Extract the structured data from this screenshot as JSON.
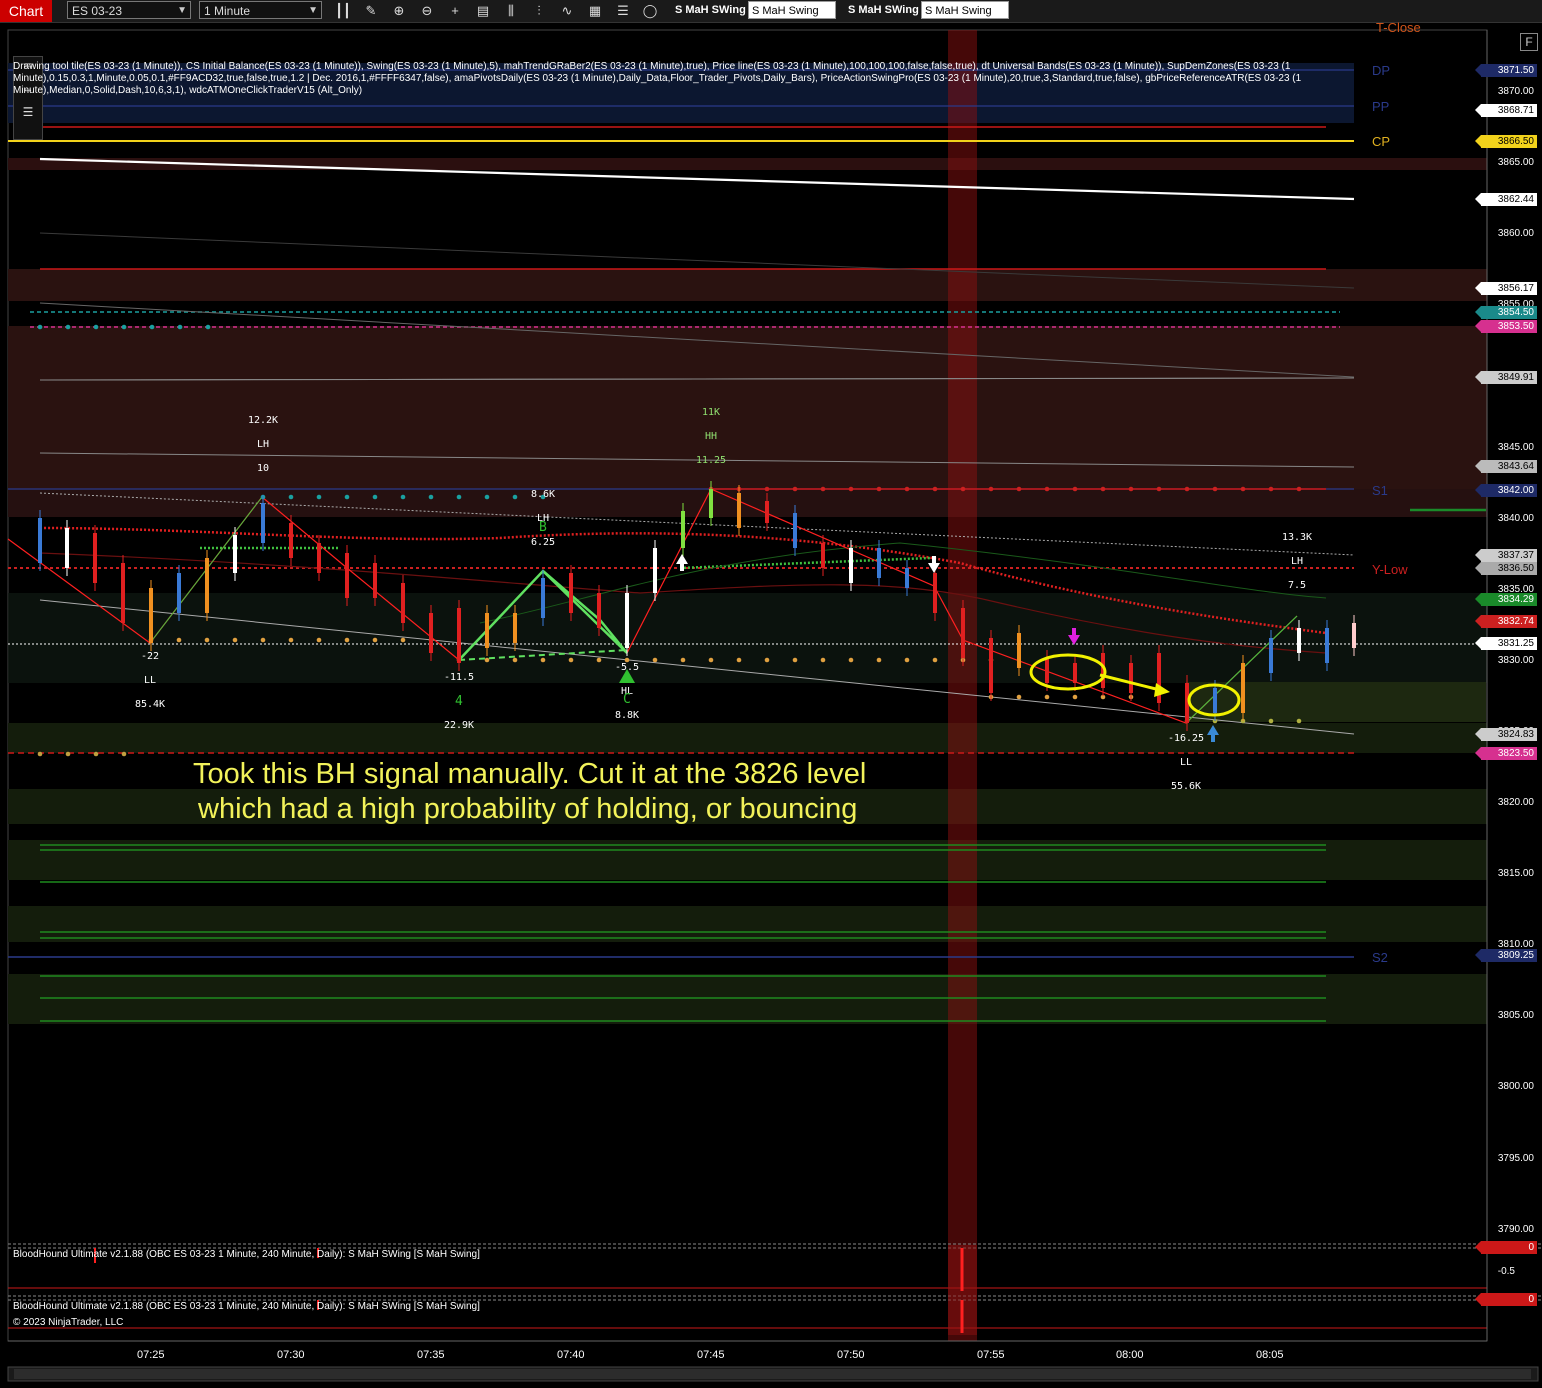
{
  "toolbar": {
    "tab_label": "Chart",
    "instrument": "ES 03-23",
    "interval": "1 Minute",
    "buttons": [
      {
        "label": "S MaH SWing",
        "style": "dark"
      },
      {
        "label": "S MaH Swing",
        "style": "light"
      },
      {
        "label": "S MaH SWing",
        "style": "dark"
      },
      {
        "label": "S MaH Swing",
        "style": "light"
      }
    ]
  },
  "indicator_text": "Drawing tool tile(ES 03-23 (1 Minute)), CS Initial Balance(ES 03-23 (1 Minute)), Swing(ES 03-23 (1 Minute),5), mahTrendGRaBer2(ES 03-23 (1 Minute),true), Price line(ES 03-23 (1 Minute),100,100,100,false,false,true), dt Universal Bands(ES 03-23 (1 Minute)), SupDemZones(ES 03-23 (1 Minute),0.15,0.3,1,Minute,0.05,0.1,#FF9ACD32,true,false,true,1.2 | Dec. 2016,1,#FFFF6347,false), amaPivotsDaily(ES 03-23 (1 Minute),Daily_Data,Floor_Trader_Pivots,Daily_Bars), PriceActionSwingPro(ES 03-23 (1 Minute),20,true,3,Standard,true,false), gbPriceReferenceATR(ES 03-23 (1 Minute),Median,0,Solid,Dash,10,6,3,1), wdcATMOneClickTraderV15 (Alt_Only)",
  "f_button": "F",
  "y_axis_ticks": [
    "3870.00",
    "3865.00",
    "3860.00",
    "3855.00",
    "3850.00",
    "3845.00",
    "3840.00",
    "3835.00",
    "3830.00",
    "3825.00",
    "3820.00",
    "3815.00",
    "3810.00",
    "3805.00",
    "3800.00",
    "3795.00",
    "3790.00"
  ],
  "price_tags": [
    {
      "value": "3871.50",
      "bg": "#1e2a66",
      "fg": "#ffffff"
    },
    {
      "value": "3868.71",
      "bg": "#ffffff",
      "fg": "#000000"
    },
    {
      "value": "3866.50",
      "bg": "#f2d21b",
      "fg": "#000000"
    },
    {
      "value": "3862.44",
      "bg": "#ffffff",
      "fg": "#000000"
    },
    {
      "value": "3856.17",
      "bg": "#ffffff",
      "fg": "#000000"
    },
    {
      "value": "3854.50",
      "bg": "#1a8a8a",
      "fg": "#ffffff"
    },
    {
      "value": "3853.50",
      "bg": "#d6308f",
      "fg": "#ffffff"
    },
    {
      "value": "3849.91",
      "bg": "#cccccc",
      "fg": "#000000"
    },
    {
      "value": "3843.64",
      "bg": "#bbbbbb",
      "fg": "#000000"
    },
    {
      "value": "3842.00",
      "bg": "#1e2a66",
      "fg": "#ffffff"
    },
    {
      "value": "3837.37",
      "bg": "#cccccc",
      "fg": "#000000"
    },
    {
      "value": "3836.50",
      "bg": "#aaaaaa",
      "fg": "#000000"
    },
    {
      "value": "3834.29",
      "bg": "#1a8a2a",
      "fg": "#ffffff"
    },
    {
      "value": "3832.74",
      "bg": "#cc2020",
      "fg": "#ffffff"
    },
    {
      "value": "3831.25",
      "bg": "#ffffff",
      "fg": "#000000"
    },
    {
      "value": "3824.83",
      "bg": "#cccccc",
      "fg": "#000000"
    },
    {
      "value": "3823.50",
      "bg": "#d6308f",
      "fg": "#ffffff"
    },
    {
      "value": "3809.25",
      "bg": "#1e2a66",
      "fg": "#ffffff"
    }
  ],
  "pivot_labels": [
    {
      "text": "T-Close",
      "color": "#d0541a"
    },
    {
      "text": "DP",
      "color": "#2a3a8a"
    },
    {
      "text": "PP",
      "color": "#2a3a8a"
    },
    {
      "text": "CP",
      "color": "#e0b020"
    },
    {
      "text": "S1",
      "color": "#2a3a8a"
    },
    {
      "text": "Y-Low",
      "color": "#cc2020"
    },
    {
      "text": "S2",
      "color": "#2a3a8a"
    }
  ],
  "swing_annotations": [
    {
      "lines": [
        "12.2K",
        "LH",
        "10"
      ],
      "color": "#ffffff"
    },
    {
      "lines": [
        "-22",
        "LL",
        "85.4K"
      ],
      "color": "#ffffff"
    },
    {
      "lines": [
        "-11.5",
        "",
        "22.9K"
      ],
      "color": "#ffffff"
    },
    {
      "lines": [
        "8.6K",
        "LH",
        "6.25"
      ],
      "color": "#ffffff"
    },
    {
      "lines": [
        "11K",
        "HH",
        "11.25"
      ],
      "color": "#90e070"
    },
    {
      "lines": [
        "-5.5",
        "HL",
        "8.8K"
      ],
      "color": "#ffffff"
    },
    {
      "lines": [
        "13.3K",
        "LH",
        "7.5"
      ],
      "color": "#ffffff"
    },
    {
      "lines": [
        "-16.25",
        "LL",
        "55.6K"
      ],
      "color": "#ffffff"
    }
  ],
  "pattern_letters": [
    "4",
    "B",
    "C"
  ],
  "comment": [
    "Took this BH signal manually. Cut it at the 3826 level",
    "which had a high probability of holding, or bouncing"
  ],
  "sub_panels": [
    {
      "title": "BloodHound Ultimate v2.1.88 (OBC ES 03-23 1 Minute, 240 Minute, Daily): S MaH SWing  [S MaH Swing]",
      "ticks": [
        "0",
        "-0.5"
      ]
    },
    {
      "title": "BloodHound Ultimate v2.1.88 (OBC ES 03-23 1 Minute, 240 Minute, Daily): S MaH SWing  [S MaH Swing]",
      "ticks": [
        "0"
      ]
    }
  ],
  "copyright": "© 2023 NinjaTrader, LLC",
  "x_axis_ticks": [
    "07:25",
    "07:30",
    "07:35",
    "07:40",
    "07:45",
    "07:50",
    "07:55",
    "08:00",
    "08:05"
  ]
}
